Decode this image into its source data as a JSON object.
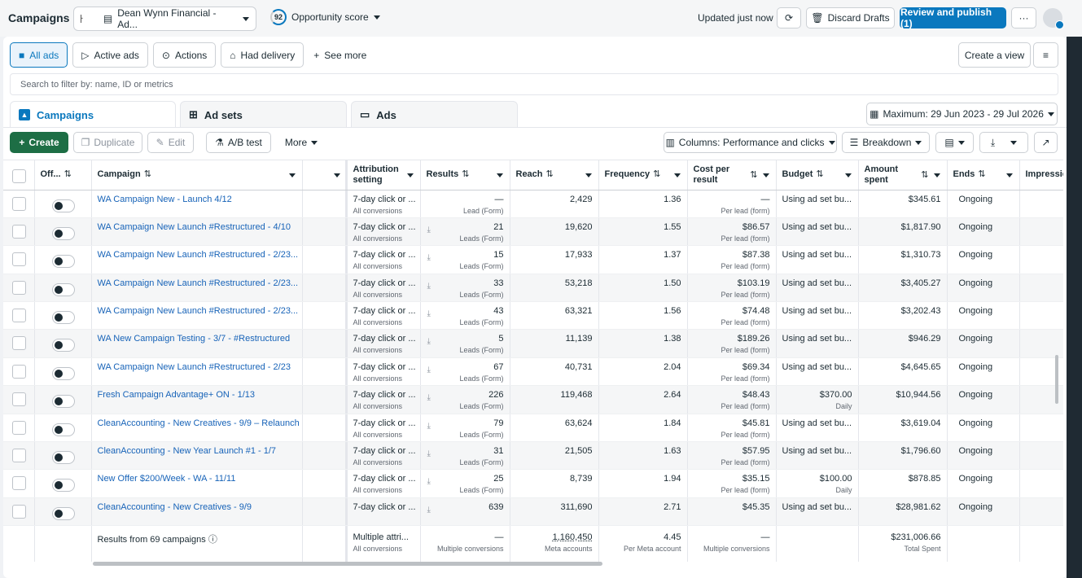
{
  "header": {
    "title": "Campaigns",
    "account": "Dean Wynn Financial - Ad...",
    "opportunity_score": "92",
    "opportunity_label": "Opportunity score",
    "updated": "Updated just now",
    "discard": "Discard Drafts",
    "publish": "Review and publish (1)"
  },
  "filters": {
    "all_ads": "All ads",
    "active_ads": "Active ads",
    "actions": "Actions",
    "had_delivery": "Had delivery",
    "see_more": "See more",
    "create_view": "Create a view"
  },
  "search": {
    "placeholder": "Search to filter by: name, ID or metrics"
  },
  "tabs": {
    "campaigns": "Campaigns",
    "ad_sets": "Ad sets",
    "ads": "Ads"
  },
  "date_range": "Maximum: 29 Jun 2023 - 29 Jul 2026",
  "toolbar": {
    "create": "Create",
    "duplicate": "Duplicate",
    "edit": "Edit",
    "ab_test": "A/B test",
    "more": "More",
    "columns": "Columns: Performance and clicks",
    "breakdown": "Breakdown"
  },
  "columns": {
    "off": "Off...",
    "campaign": "Campaign",
    "attribution": "Attribution setting",
    "results": "Results",
    "reach": "Reach",
    "frequency": "Frequency",
    "cost_per_result": "Cost per result",
    "budget": "Budget",
    "amount_spent": "Amount spent",
    "ends": "Ends",
    "impressions": "Impressio"
  },
  "rows": [
    {
      "name": "WA Campaign New - Launch 4/12",
      "attr": "7-day click or ...",
      "attr_sub": "All conversions",
      "results": "—",
      "results_sub": "Lead (Form)",
      "reach": "2,429",
      "freq": "1.36",
      "cpr": "—",
      "cpr_sub": "Per lead (form)",
      "budget": "Using ad set bu...",
      "budget_sub": "",
      "spent": "$345.61",
      "ends": "Ongoing"
    },
    {
      "name": "WA Campaign New Launch #Restructured - 4/10",
      "attr": "7-day click or ...",
      "attr_sub": "All conversions",
      "results": "21",
      "results_sub": "Leads (Form)",
      "reach": "19,620",
      "freq": "1.55",
      "cpr": "$86.57",
      "cpr_sub": "Per lead (form)",
      "budget": "Using ad set bu...",
      "budget_sub": "",
      "spent": "$1,817.90",
      "ends": "Ongoing"
    },
    {
      "name": "WA Campaign New Launch #Restructured - 2/23...",
      "attr": "7-day click or ...",
      "attr_sub": "All conversions",
      "results": "15",
      "results_sub": "Leads (Form)",
      "reach": "17,933",
      "freq": "1.37",
      "cpr": "$87.38",
      "cpr_sub": "Per lead (form)",
      "budget": "Using ad set bu...",
      "budget_sub": "",
      "spent": "$1,310.73",
      "ends": "Ongoing"
    },
    {
      "name": "WA Campaign New Launch #Restructured - 2/23...",
      "attr": "7-day click or ...",
      "attr_sub": "All conversions",
      "results": "33",
      "results_sub": "Leads (Form)",
      "reach": "53,218",
      "freq": "1.50",
      "cpr": "$103.19",
      "cpr_sub": "Per lead (form)",
      "budget": "Using ad set bu...",
      "budget_sub": "",
      "spent": "$3,405.27",
      "ends": "Ongoing"
    },
    {
      "name": "WA Campaign New Launch #Restructured - 2/23...",
      "attr": "7-day click or ...",
      "attr_sub": "All conversions",
      "results": "43",
      "results_sub": "Leads (Form)",
      "reach": "63,321",
      "freq": "1.56",
      "cpr": "$74.48",
      "cpr_sub": "Per lead (form)",
      "budget": "Using ad set bu...",
      "budget_sub": "",
      "spent": "$3,202.43",
      "ends": "Ongoing"
    },
    {
      "name": "WA New Campaign Testing - 3/7 - #Restructured",
      "attr": "7-day click or ...",
      "attr_sub": "All conversions",
      "results": "5",
      "results_sub": "Leads (Form)",
      "reach": "11,139",
      "freq": "1.38",
      "cpr": "$189.26",
      "cpr_sub": "Per lead (form)",
      "budget": "Using ad set bu...",
      "budget_sub": "",
      "spent": "$946.29",
      "ends": "Ongoing"
    },
    {
      "name": "WA Campaign New Launch #Restructured - 2/23",
      "attr": "7-day click or ...",
      "attr_sub": "All conversions",
      "results": "67",
      "results_sub": "Leads (Form)",
      "reach": "40,731",
      "freq": "2.04",
      "cpr": "$69.34",
      "cpr_sub": "Per lead (form)",
      "budget": "Using ad set bu...",
      "budget_sub": "",
      "spent": "$4,645.65",
      "ends": "Ongoing"
    },
    {
      "name": "Fresh Campaign Advantage+ ON - 1/13",
      "attr": "7-day click or ...",
      "attr_sub": "All conversions",
      "results": "226",
      "results_sub": "Leads (Form)",
      "reach": "119,468",
      "freq": "2.64",
      "cpr": "$48.43",
      "cpr_sub": "Per lead (form)",
      "budget": "$370.00",
      "budget_sub": "Daily",
      "spent": "$10,944.56",
      "ends": "Ongoing"
    },
    {
      "name": "CleanAccounting - New Creatives - 9/9 – Relaunch",
      "attr": "7-day click or ...",
      "attr_sub": "All conversions",
      "results": "79",
      "results_sub": "Leads (Form)",
      "reach": "63,624",
      "freq": "1.84",
      "cpr": "$45.81",
      "cpr_sub": "Per lead (form)",
      "budget": "Using ad set bu...",
      "budget_sub": "",
      "spent": "$3,619.04",
      "ends": "Ongoing"
    },
    {
      "name": "CleanAccounting - New Year Launch #1 - 1/7",
      "attr": "7-day click or ...",
      "attr_sub": "All conversions",
      "results": "31",
      "results_sub": "Leads (Form)",
      "reach": "21,505",
      "freq": "1.63",
      "cpr": "$57.95",
      "cpr_sub": "Per lead (form)",
      "budget": "Using ad set bu...",
      "budget_sub": "",
      "spent": "$1,796.60",
      "ends": "Ongoing"
    },
    {
      "name": "New Offer $200/Week - WA - 11/11",
      "attr": "7-day click or ...",
      "attr_sub": "All conversions",
      "results": "25",
      "results_sub": "Leads (Form)",
      "reach": "8,739",
      "freq": "1.94",
      "cpr": "$35.15",
      "cpr_sub": "Per lead (form)",
      "budget": "$100.00",
      "budget_sub": "Daily",
      "spent": "$878.85",
      "ends": "Ongoing"
    },
    {
      "name": "CleanAccounting - New Creatives - 9/9",
      "attr": "7-day click or ...",
      "attr_sub": "",
      "results": "639",
      "results_sub": "",
      "reach": "311,690",
      "freq": "2.71",
      "cpr": "$45.35",
      "cpr_sub": "",
      "budget": "Using ad set bu...",
      "budget_sub": "",
      "spent": "$28,981.62",
      "ends": "Ongoing"
    }
  ],
  "total": {
    "label": "Results from 69 campaigns",
    "attr": "Multiple attri...",
    "attr_sub": "All conversions",
    "results": "—",
    "results_sub": "Multiple conversions",
    "reach": "1,160,450",
    "reach_sub": "Meta accounts",
    "freq": "4.45",
    "freq_sub": "Per Meta account",
    "cpr": "—",
    "cpr_sub": "Multiple conversions",
    "spent": "$231,006.66",
    "spent_sub": "Total Spent"
  },
  "colors": {
    "accent": "#0a78be",
    "create_green": "#1d6e45",
    "link": "#1763b8"
  }
}
